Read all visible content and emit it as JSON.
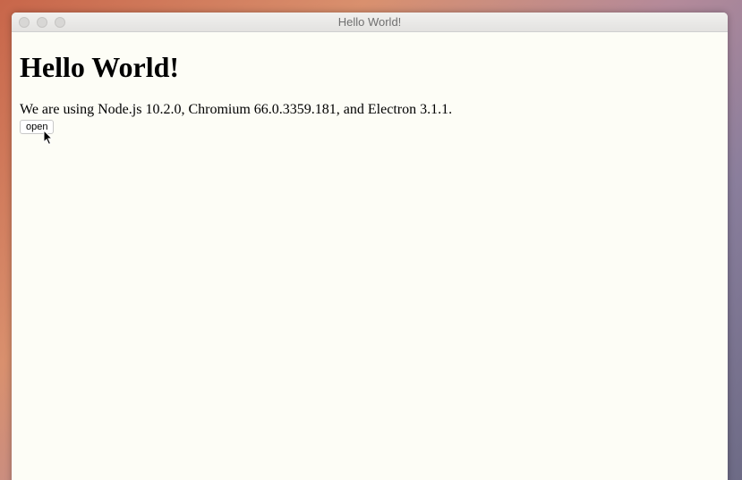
{
  "window": {
    "title": "Hello World!"
  },
  "page": {
    "heading": "Hello World!",
    "versions_text": "We are using Node.js 10.2.0, Chromium 66.0.3359.181, and Electron 3.1.1.",
    "open_button": "open"
  }
}
